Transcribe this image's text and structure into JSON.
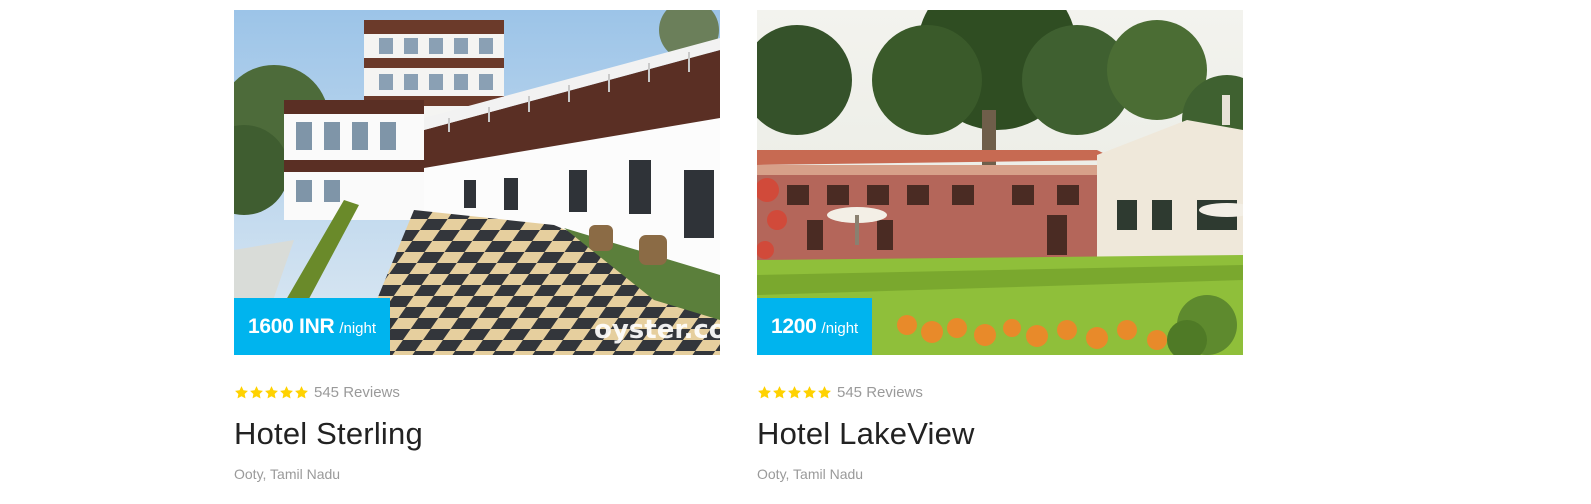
{
  "colors": {
    "price_badge": "#00b4ee",
    "star": "#ffd200",
    "muted_text": "#9a9a9a",
    "title_text": "#222222"
  },
  "hotels": [
    {
      "name": "Hotel Sterling",
      "price": "1600 INR",
      "price_unit": "/night",
      "rating": 5,
      "reviews": "545 Reviews",
      "location": "Ooty, Tamil Nadu",
      "image_watermark": "oyster.com",
      "image_icon": "hotel-photo"
    },
    {
      "name": "Hotel LakeView",
      "price": "1200",
      "price_unit": "/night",
      "rating": 5,
      "reviews": "545 Reviews",
      "location": "Ooty, Tamil Nadu",
      "image_icon": "hotel-photo"
    }
  ]
}
